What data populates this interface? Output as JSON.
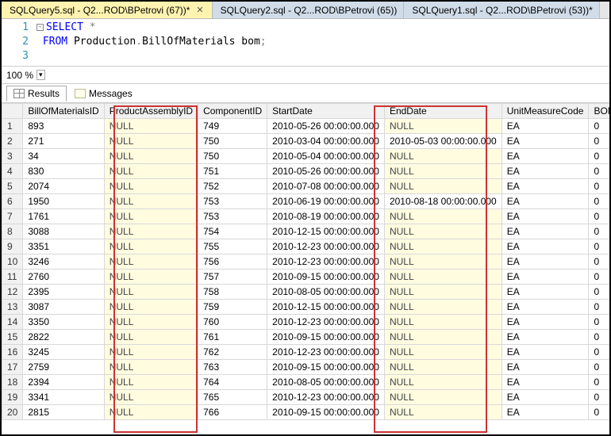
{
  "tabs": [
    {
      "label": "SQLQuery5.sql - Q2...ROD\\BPetrovi (67))*",
      "active": true,
      "closable": true
    },
    {
      "label": "SQLQuery2.sql - Q2...ROD\\BPetrovi (65))",
      "active": false,
      "closable": false
    },
    {
      "label": "SQLQuery1.sql - Q2...ROD\\BPetrovi (53))*",
      "active": false,
      "closable": false
    }
  ],
  "editor": {
    "lines": [
      "1",
      "2",
      "3"
    ],
    "code_html": "<span class='minus'>-</span><span class='kw'>SELECT</span> <span class='grey'>*</span>\n <span class='kw'>FROM</span> <span class='plain'>Production</span><span class='grey'>.</span><span class='plain'>BillOfMaterials bom</span><span class='grey'>;</span>\n "
  },
  "zoom": {
    "value": "100 %"
  },
  "result_tabs": {
    "results": "Results",
    "messages": "Messages"
  },
  "columns": [
    "BillOfMaterialsID",
    "ProductAssemblyID",
    "ComponentID",
    "StartDate",
    "EndDate",
    "UnitMeasureCode",
    "BOMLevel"
  ],
  "rows": [
    {
      "n": 1,
      "b": "893",
      "pa": "NULL",
      "c": "749",
      "s": "2010-05-26 00:00:00.000",
      "e": "NULL",
      "u": "EA",
      "l": "0"
    },
    {
      "n": 2,
      "b": "271",
      "pa": "NULL",
      "c": "750",
      "s": "2010-03-04 00:00:00.000",
      "e": "2010-05-03 00:00:00.000",
      "u": "EA",
      "l": "0"
    },
    {
      "n": 3,
      "b": "34",
      "pa": "NULL",
      "c": "750",
      "s": "2010-05-04 00:00:00.000",
      "e": "NULL",
      "u": "EA",
      "l": "0"
    },
    {
      "n": 4,
      "b": "830",
      "pa": "NULL",
      "c": "751",
      "s": "2010-05-26 00:00:00.000",
      "e": "NULL",
      "u": "EA",
      "l": "0"
    },
    {
      "n": 5,
      "b": "2074",
      "pa": "NULL",
      "c": "752",
      "s": "2010-07-08 00:00:00.000",
      "e": "NULL",
      "u": "EA",
      "l": "0"
    },
    {
      "n": 6,
      "b": "1950",
      "pa": "NULL",
      "c": "753",
      "s": "2010-06-19 00:00:00.000",
      "e": "2010-08-18 00:00:00.000",
      "u": "EA",
      "l": "0"
    },
    {
      "n": 7,
      "b": "1761",
      "pa": "NULL",
      "c": "753",
      "s": "2010-08-19 00:00:00.000",
      "e": "NULL",
      "u": "EA",
      "l": "0"
    },
    {
      "n": 8,
      "b": "3088",
      "pa": "NULL",
      "c": "754",
      "s": "2010-12-15 00:00:00.000",
      "e": "NULL",
      "u": "EA",
      "l": "0"
    },
    {
      "n": 9,
      "b": "3351",
      "pa": "NULL",
      "c": "755",
      "s": "2010-12-23 00:00:00.000",
      "e": "NULL",
      "u": "EA",
      "l": "0"
    },
    {
      "n": 10,
      "b": "3246",
      "pa": "NULL",
      "c": "756",
      "s": "2010-12-23 00:00:00.000",
      "e": "NULL",
      "u": "EA",
      "l": "0"
    },
    {
      "n": 11,
      "b": "2760",
      "pa": "NULL",
      "c": "757",
      "s": "2010-09-15 00:00:00.000",
      "e": "NULL",
      "u": "EA",
      "l": "0"
    },
    {
      "n": 12,
      "b": "2395",
      "pa": "NULL",
      "c": "758",
      "s": "2010-08-05 00:00:00.000",
      "e": "NULL",
      "u": "EA",
      "l": "0"
    },
    {
      "n": 13,
      "b": "3087",
      "pa": "NULL",
      "c": "759",
      "s": "2010-12-15 00:00:00.000",
      "e": "NULL",
      "u": "EA",
      "l": "0"
    },
    {
      "n": 14,
      "b": "3350",
      "pa": "NULL",
      "c": "760",
      "s": "2010-12-23 00:00:00.000",
      "e": "NULL",
      "u": "EA",
      "l": "0"
    },
    {
      "n": 15,
      "b": "2822",
      "pa": "NULL",
      "c": "761",
      "s": "2010-09-15 00:00:00.000",
      "e": "NULL",
      "u": "EA",
      "l": "0"
    },
    {
      "n": 16,
      "b": "3245",
      "pa": "NULL",
      "c": "762",
      "s": "2010-12-23 00:00:00.000",
      "e": "NULL",
      "u": "EA",
      "l": "0"
    },
    {
      "n": 17,
      "b": "2759",
      "pa": "NULL",
      "c": "763",
      "s": "2010-09-15 00:00:00.000",
      "e": "NULL",
      "u": "EA",
      "l": "0"
    },
    {
      "n": 18,
      "b": "2394",
      "pa": "NULL",
      "c": "764",
      "s": "2010-08-05 00:00:00.000",
      "e": "NULL",
      "u": "EA",
      "l": "0"
    },
    {
      "n": 19,
      "b": "3341",
      "pa": "NULL",
      "c": "765",
      "s": "2010-12-23 00:00:00.000",
      "e": "NULL",
      "u": "EA",
      "l": "0"
    },
    {
      "n": 20,
      "b": "2815",
      "pa": "NULL",
      "c": "766",
      "s": "2010-09-15 00:00:00.000",
      "e": "NULL",
      "u": "EA",
      "l": "0"
    }
  ]
}
